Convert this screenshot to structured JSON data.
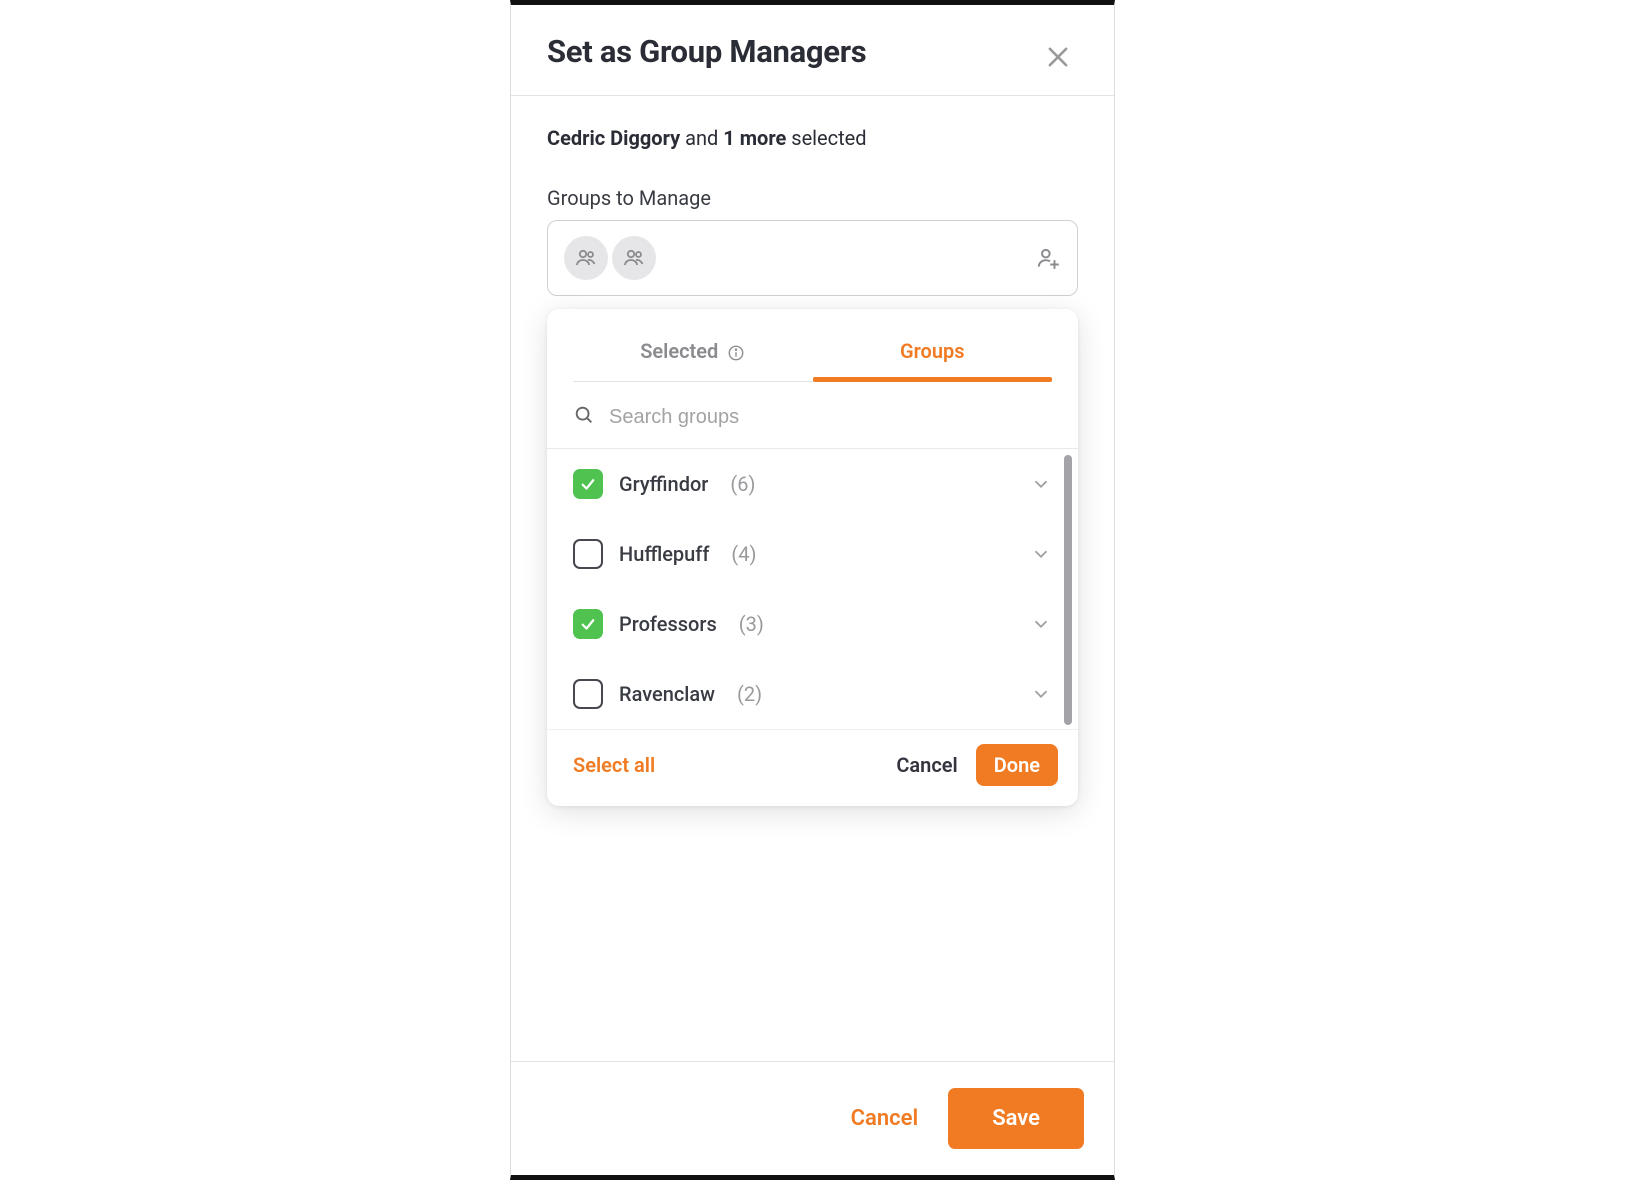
{
  "modal": {
    "title": "Set as Group Managers",
    "summary": {
      "person": "Cedric Diggory",
      "and": " and ",
      "more_count": "1 more",
      "suffix": " selected"
    },
    "field_label": "Groups to Manage"
  },
  "dropdown": {
    "tabs": {
      "selected": "Selected",
      "groups": "Groups"
    },
    "search_placeholder": "Search groups",
    "groups": [
      {
        "name": "Gryffindor",
        "count": "(6)",
        "checked": true
      },
      {
        "name": "Hufflepuff",
        "count": "(4)",
        "checked": false
      },
      {
        "name": "Professors",
        "count": "(3)",
        "checked": true
      },
      {
        "name": "Ravenclaw",
        "count": "(2)",
        "checked": false
      }
    ],
    "footer": {
      "select_all": "Select all",
      "cancel": "Cancel",
      "done": "Done"
    }
  },
  "footer": {
    "cancel": "Cancel",
    "save": "Save"
  }
}
